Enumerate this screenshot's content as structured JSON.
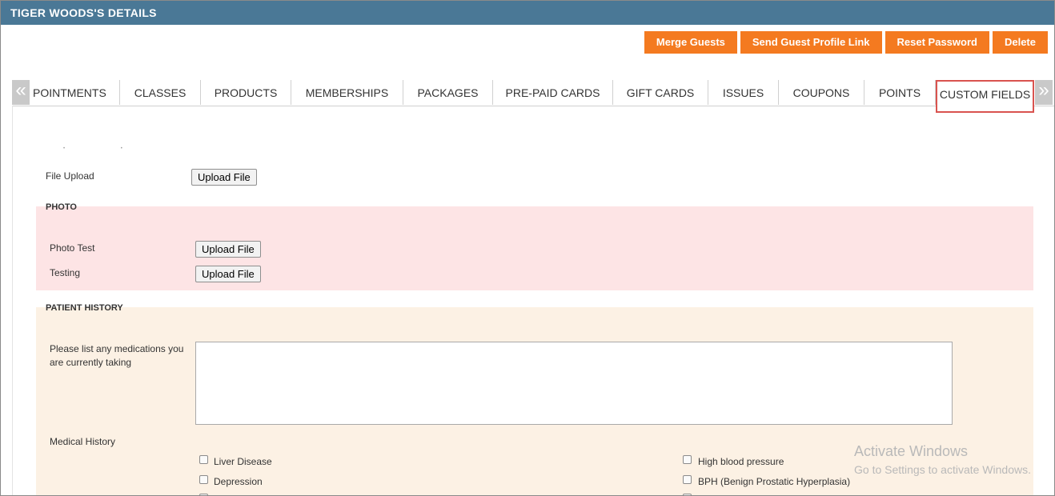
{
  "title": "TIGER WOODS'S DETAILS",
  "actions": {
    "merge_guests": "Merge Guests",
    "send_profile_link": "Send Guest Profile Link",
    "reset_password": "Reset Password",
    "delete": "Delete"
  },
  "tabs": [
    "POINTMENTS",
    "CLASSES",
    "PRODUCTS",
    "MEMBERSHIPS",
    "PACKAGES",
    "PRE-PAID CARDS",
    "GIFT CARDS",
    "ISSUES",
    "COUPONS",
    "POINTS",
    "CUSTOM FIELDS"
  ],
  "active_tab": "CUSTOM FIELDS",
  "arrows": {
    "left": "«",
    "right": "»"
  },
  "file_upload": {
    "label": "File Upload",
    "button": "Upload File"
  },
  "photo_section": {
    "title": "PHOTO",
    "fields": [
      {
        "label": "Photo Test",
        "button": "Upload File"
      },
      {
        "label": "Testing",
        "button": "Upload File"
      }
    ]
  },
  "history_section": {
    "title": "PATIENT HISTORY",
    "medications_label_line1": "Please list any medications you",
    "medications_label_line2": "are currently taking",
    "medications_value": "",
    "medical_history_label": "Medical History",
    "conditions_left": [
      "Liver Disease",
      "Depression"
    ],
    "conditions_right": [
      "High blood pressure",
      "BPH (Benign Prostatic Hyperplasia)"
    ]
  },
  "watermark": {
    "line1": "Activate Windows",
    "line2": "Go to Settings to activate Windows."
  },
  "colors": {
    "titlebar": "#4a7896",
    "action_buttons": "#f47a20",
    "active_tab_border": "#d9534f",
    "photo_bg": "#fde4e5",
    "history_bg": "#fcf1e4"
  }
}
